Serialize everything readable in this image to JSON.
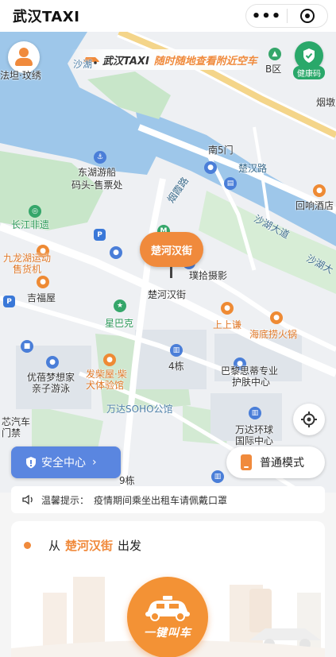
{
  "header": {
    "title": "武汉TAXI",
    "more_icon": "more-dots-icon",
    "close_icon": "target-close-icon"
  },
  "map": {
    "banner": {
      "brand": "武汉TAXI",
      "slogan": "随时随地查看附近空车"
    },
    "health_code_label": "健康码",
    "pin_label": "楚河汉街",
    "labels": [
      {
        "id": "shahu-wan",
        "text": "沙湖",
        "cls": "water"
      },
      {
        "id": "b-zone",
        "text": "B区",
        "cls": ""
      },
      {
        "id": "yanxiao",
        "text": "烟墩",
        "cls": ""
      },
      {
        "id": "south-gate",
        "text": "南5门",
        "cls": ""
      },
      {
        "id": "chuhan-road",
        "text": "楚汉路",
        "cls": "road"
      },
      {
        "id": "donghu-boat-1",
        "text": "东湖游船",
        "cls": ""
      },
      {
        "id": "donghu-boat-2",
        "text": "码头-售票处",
        "cls": ""
      },
      {
        "id": "yanxia-road",
        "text": "烟霞路",
        "cls": "road"
      },
      {
        "id": "huixiang-hotel",
        "text": "回响酒店",
        "cls": ""
      },
      {
        "id": "shahu-avenue",
        "text": "沙湖大道",
        "cls": "road"
      },
      {
        "id": "shahu-avenue-2",
        "text": "沙湖大",
        "cls": "road"
      },
      {
        "id": "changjiang",
        "text": "长江非遗",
        "cls": "green"
      },
      {
        "id": "jiulong-1",
        "text": "九龙湖运动",
        "cls": "orange"
      },
      {
        "id": "jiulong-2",
        "text": "售货机",
        "cls": "orange"
      },
      {
        "id": "jixiangwu",
        "text": "吉福屋",
        "cls": ""
      },
      {
        "id": "pushi",
        "text": "璞拾摄影",
        "cls": ""
      },
      {
        "id": "chuhe-street",
        "text": "楚河汉街",
        "cls": ""
      },
      {
        "id": "starbucks",
        "text": "星巴克",
        "cls": "green"
      },
      {
        "id": "shangshang",
        "text": "上上谦",
        "cls": "orange"
      },
      {
        "id": "haidilao",
        "text": "海底捞火锅",
        "cls": "orange"
      },
      {
        "id": "youbei-1",
        "text": "优蓓梦想家",
        "cls": ""
      },
      {
        "id": "youbei-2",
        "text": "亲子游泳",
        "cls": ""
      },
      {
        "id": "faxing-1",
        "text": "发柴屋·柴",
        "cls": "orange"
      },
      {
        "id": "faxing-2",
        "text": "犬体验馆",
        "cls": "orange"
      },
      {
        "id": "building-4",
        "text": "4栋",
        "cls": ""
      },
      {
        "id": "bali-1",
        "text": "巴黎思蒂专业",
        "cls": ""
      },
      {
        "id": "bali-2",
        "text": "护肤中心",
        "cls": ""
      },
      {
        "id": "wanda-soho",
        "text": "万达SOHO公馆",
        "cls": "water"
      },
      {
        "id": "wanda-global-1",
        "text": "万达环球",
        "cls": ""
      },
      {
        "id": "wanda-global-2",
        "text": "国际中心",
        "cls": ""
      },
      {
        "id": "car-1",
        "text": "芯汽车",
        "cls": ""
      },
      {
        "id": "car-2",
        "text": "门禁",
        "cls": ""
      },
      {
        "id": "jiadong",
        "text": "9栋",
        "cls": ""
      },
      {
        "id": "fadian",
        "text": "法坦·玟绣",
        "cls": ""
      }
    ],
    "safety_label": "安全中心",
    "mode_label": "普通模式"
  },
  "notice": {
    "prefix": "温馨提示：",
    "text": "疫情期间乘坐出租车请佩戴口罩"
  },
  "card": {
    "from_word": "从",
    "origin": "楚河汉街",
    "depart_word": "出发",
    "call_button_label": "一键叫车"
  },
  "colors": {
    "accent": "#f08a3c",
    "safety_blue": "#5a86e0",
    "health_green": "#2aa86a"
  }
}
